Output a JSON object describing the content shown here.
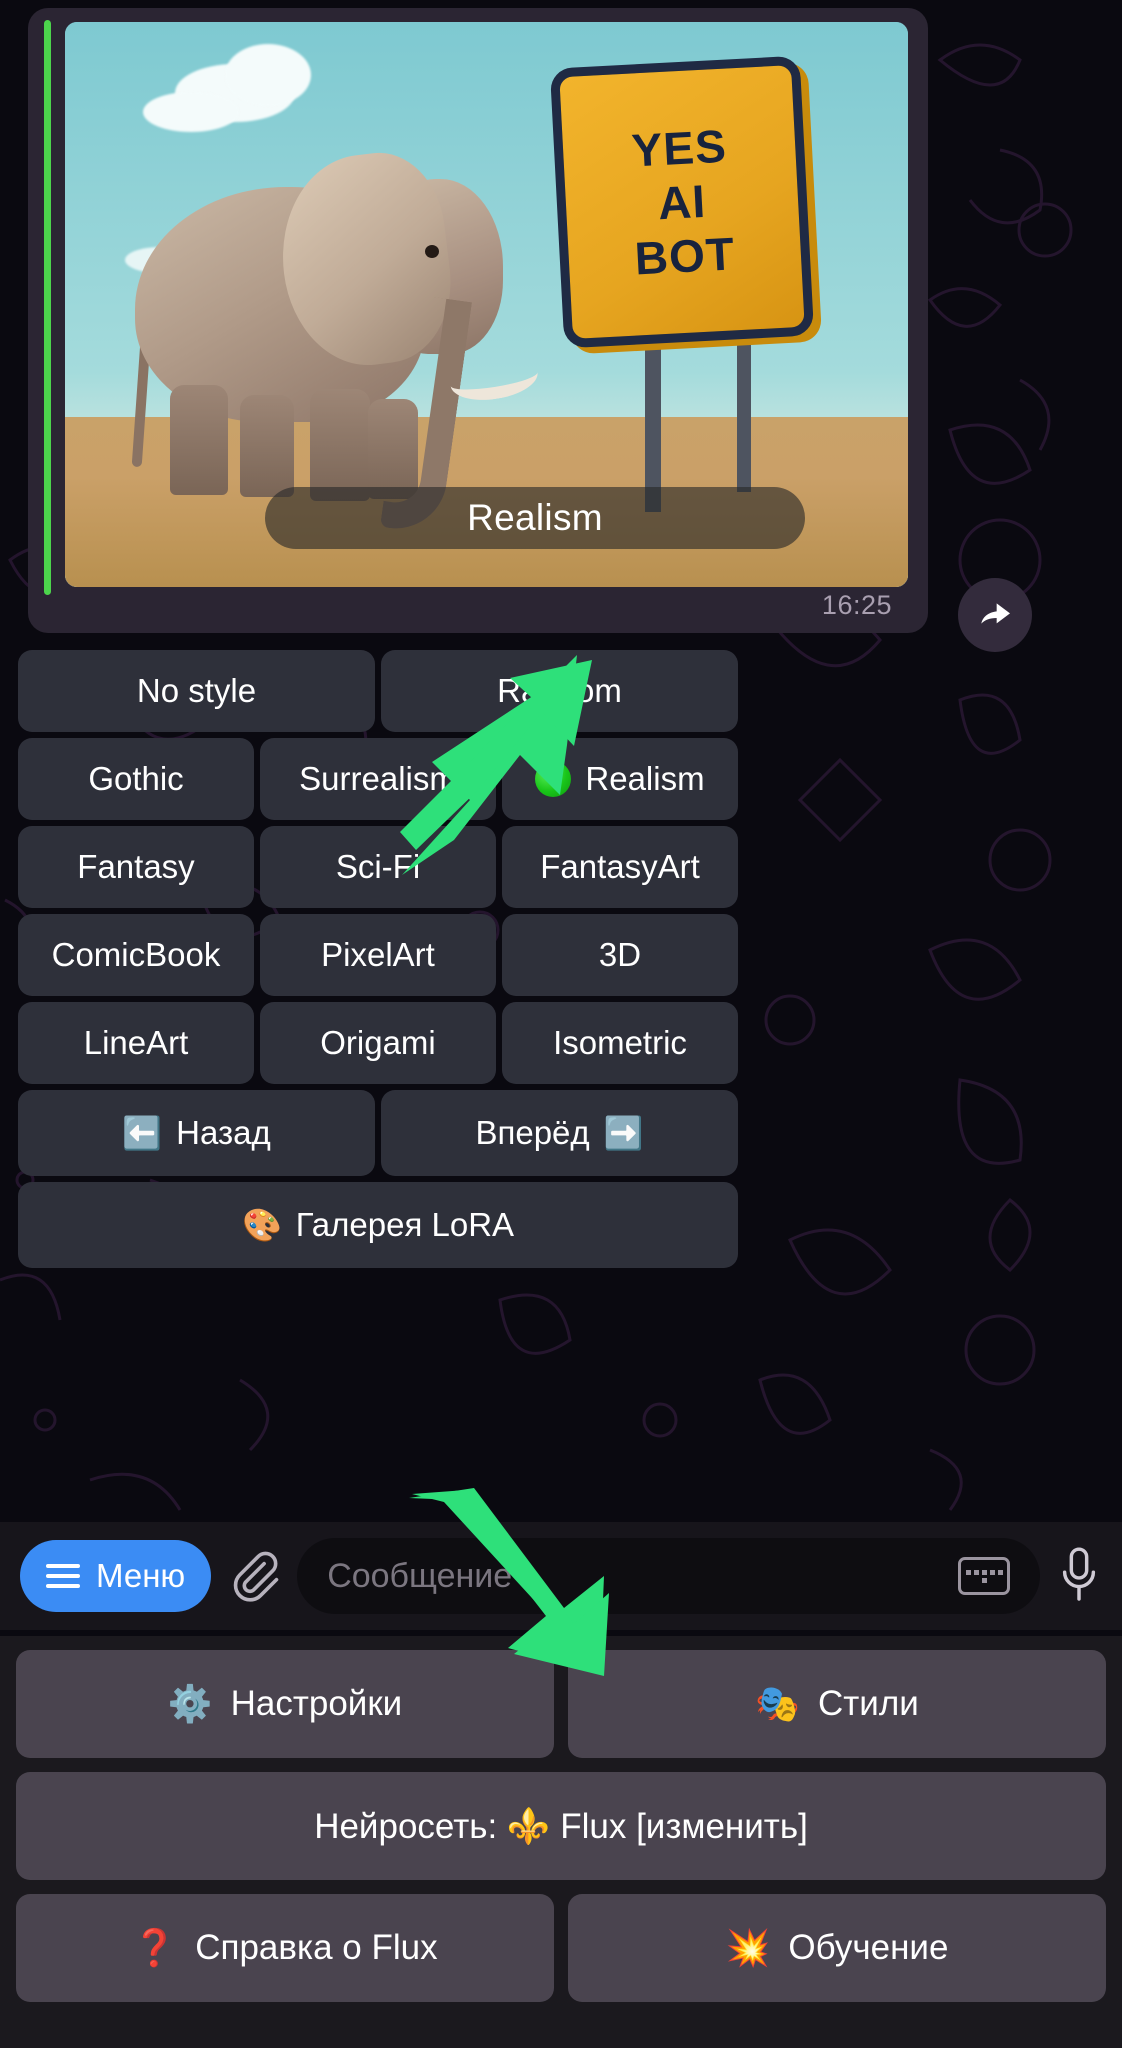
{
  "message": {
    "image_caption": "Realism",
    "time": "16:25",
    "sign_lines": [
      "YES",
      "AI",
      "BOT"
    ],
    "forward_icon": "forward-arrow-icon"
  },
  "inline_keyboard": {
    "rows": [
      [
        {
          "label": "No style",
          "selected": false
        },
        {
          "label": "Random",
          "selected": false
        }
      ],
      [
        {
          "label": "Gothic",
          "selected": false
        },
        {
          "label": "Surrealism",
          "selected": false
        },
        {
          "label": "Realism",
          "selected": true
        }
      ],
      [
        {
          "label": "Fantasy",
          "selected": false
        },
        {
          "label": "Sci-Fi",
          "selected": false
        },
        {
          "label": "FantasyArt",
          "selected": false
        }
      ],
      [
        {
          "label": "ComicBook",
          "selected": false
        },
        {
          "label": "PixelArt",
          "selected": false
        },
        {
          "label": "3D",
          "selected": false
        }
      ],
      [
        {
          "label": "LineArt",
          "selected": false
        },
        {
          "label": "Origami",
          "selected": false
        },
        {
          "label": "Isometric",
          "selected": false
        }
      ],
      [
        {
          "label": "Назад",
          "emoji_left": "⬅️",
          "selected": false
        },
        {
          "label": "Вперёд",
          "emoji_right": "➡️",
          "selected": false
        }
      ],
      [
        {
          "label": "Галерея LoRA",
          "emoji_left": "🎨",
          "selected": false
        }
      ]
    ]
  },
  "composer": {
    "menu_label": "Меню",
    "attach_icon": "paperclip-icon",
    "placeholder": "Сообщение",
    "keyboard_icon": "keyboard-icon",
    "mic_icon": "microphone-icon"
  },
  "bottom_menu": {
    "rows": [
      [
        {
          "emoji": "⚙️",
          "label": "Настройки"
        },
        {
          "emoji": "🎭",
          "label": "Стили"
        }
      ],
      [
        {
          "label": "Нейросеть: ⚜️ Flux [изменить]"
        }
      ],
      [
        {
          "emoji": "❓",
          "label": "Справка о Flux"
        },
        {
          "emoji": "💥",
          "label": "Обучение"
        }
      ]
    ]
  },
  "colors": {
    "accent_blue": "#3b8cf4",
    "selected_dot": "#19c519",
    "annotation_green": "#2ee07a",
    "bubble_bg": "#2b2533",
    "button_bg": "#2e303a",
    "panel_button_bg": "#4a444f"
  }
}
